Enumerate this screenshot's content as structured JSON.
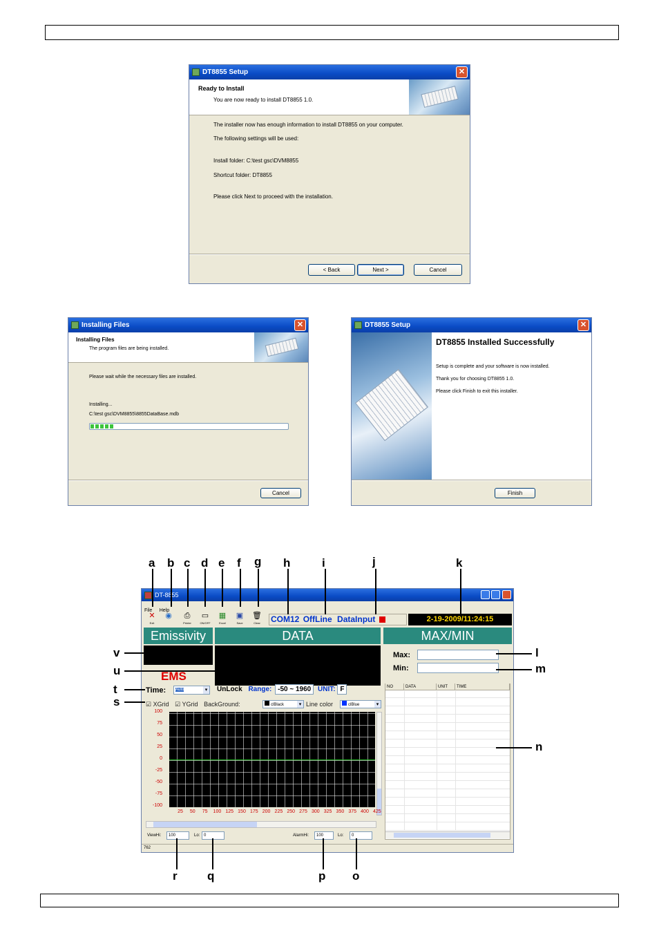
{
  "dialog1": {
    "title": "DT8855 Setup",
    "heading": "Ready to Install",
    "subheading": "You are now ready to install DT8855 1.0.",
    "line1": "The installer now has enough information to install DT8855 on your computer.",
    "line2": "The following settings will be used:",
    "line3": "Install folder: C:\\test gsc\\DVM8855",
    "line4": "Shortcut folder: DT8855",
    "line5": "Please click Next to proceed with the installation.",
    "back_label": "< Back",
    "next_label": "Next >",
    "cancel_label": "Cancel"
  },
  "dialog2": {
    "title": "Installing Files",
    "heading": "Installing Files",
    "subheading": "The program files are being installed.",
    "line1": "Please wait while the necessary files are installed.",
    "line2": "Installing...",
    "line3": "C:\\test gsc\\DVM8855\\8855DataBase.mdb",
    "progress": 0.12,
    "cancel_label": "Cancel"
  },
  "dialog3": {
    "title": "DT8855 Setup",
    "heading": "DT8855 Installed Successfully",
    "line1": "Setup is complete and your software is now installed.",
    "line2": "Thank you for choosing DT8855 1.0.",
    "line3": "Please click Finish to exit this installer.",
    "finish_label": "Finish"
  },
  "app": {
    "title": "DT-8855",
    "menu": [
      "File",
      "Help"
    ],
    "tools": [
      {
        "label": "Exit",
        "icon": "exit-icon"
      },
      {
        "label": "",
        "icon": "connect-icon"
      },
      {
        "label": "Printer",
        "icon": "printer-icon"
      },
      {
        "label": "ON/OFF",
        "icon": "onoff-icon"
      },
      {
        "label": "Excel",
        "icon": "excel-icon"
      },
      {
        "label": "Save",
        "icon": "save-icon"
      },
      {
        "label": "Clear",
        "icon": "trash-icon"
      }
    ],
    "com_port": "COM12",
    "status": "OffLine",
    "data_input": "DataInput",
    "datetime": "2-19-2009/11:24:15",
    "emissivity_header": "Emissivity",
    "data_header": "DATA",
    "maxmin_header": "MAX/MIN",
    "ems_label": "EMS",
    "max_label": "Max:",
    "min_label": "Min:",
    "time_label": "Time:",
    "time_value": "Auto",
    "unlock_label": "UnLock",
    "range_label": "Range:",
    "range_value": "-50 ~ 1960",
    "unit_label": "UNIT:",
    "unit_value": "F",
    "xgrid_label": "XGrid",
    "ygrid_label": "YGrid",
    "background_label": "BackGround:",
    "background_value": "clBlack",
    "linecolor_label": "Line color",
    "linecolor_value": "clBlue",
    "table_columns": [
      "NO",
      "DATA",
      "UNIT",
      "TIME"
    ],
    "y_ticks": [
      "100",
      "75",
      "50",
      "25",
      "0",
      "-25",
      "-50",
      "-75",
      "-100"
    ],
    "x_ticks": [
      "25",
      "50",
      "75",
      "100",
      "125",
      "150",
      "175",
      "200",
      "225",
      "250",
      "275",
      "300",
      "325",
      "350",
      "375",
      "400",
      "425"
    ],
    "viewhi_label": "ViewHi:",
    "viewhi_value": "100",
    "viewlo_label": "Lo:",
    "viewlo_value": "0",
    "alarmhi_label": "AlarmHi:",
    "alarmhi_value": "100",
    "alarmlo_label": "Lo:",
    "alarmlo_value": "0",
    "status_count": "762"
  },
  "callouts": {
    "top": [
      "a",
      "b",
      "c",
      "d",
      "e",
      "f",
      "g",
      "h",
      "i",
      "j",
      "k"
    ],
    "left": [
      "v",
      "u",
      "t",
      "s"
    ],
    "right": [
      "l",
      "m",
      "n"
    ],
    "bottom": [
      "r",
      "q",
      "p",
      "o"
    ]
  }
}
